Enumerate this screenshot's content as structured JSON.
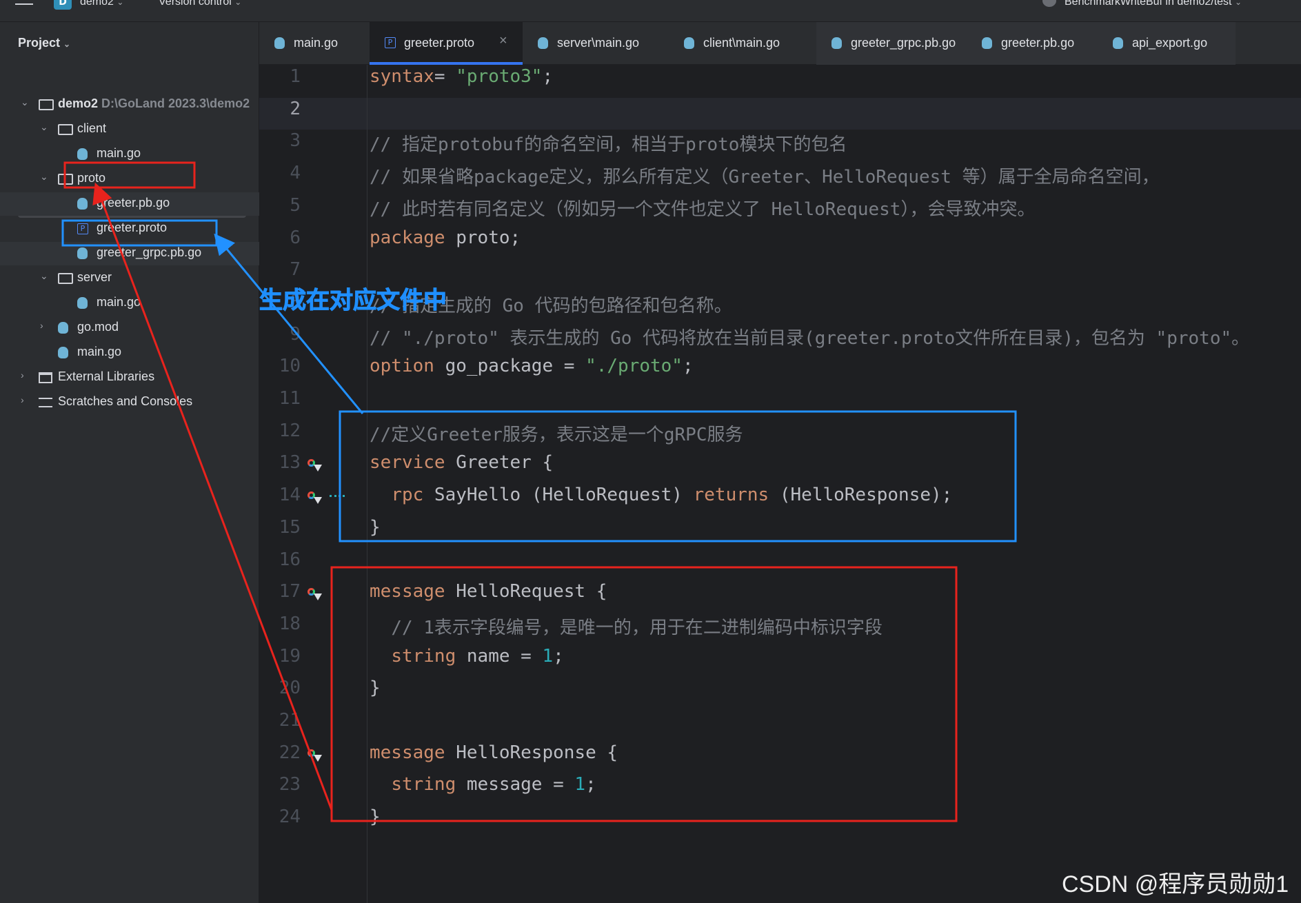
{
  "topbar": {
    "project_badge": "D",
    "project_name": "demo2",
    "vcs_label": "Version control",
    "run_config": "BenchmarkWriteBuf in demo2/test"
  },
  "sidebar": {
    "title": "Project",
    "tree": [
      {
        "label": "demo2",
        "path": "D:\\GoLand 2023.3\\demo2",
        "icon": "folder-icon"
      },
      {
        "label": "client",
        "icon": "folder-icon"
      },
      {
        "label": "main.go",
        "icon": "go-file-icon"
      },
      {
        "label": "proto",
        "icon": "folder-icon"
      },
      {
        "label": "greeter.pb.go",
        "icon": "go-file-icon"
      },
      {
        "label": "greeter.proto",
        "icon": "proto-file-icon"
      },
      {
        "label": "greeter_grpc.pb.go",
        "icon": "go-file-icon"
      },
      {
        "label": "server",
        "icon": "folder-icon"
      },
      {
        "label": "main.go",
        "icon": "go-file-icon"
      },
      {
        "label": "go.mod",
        "icon": "go-mod-icon"
      },
      {
        "label": "main.go",
        "icon": "go-file-icon"
      },
      {
        "label": "External Libraries",
        "icon": "library-icon"
      },
      {
        "label": "Scratches and Consoles",
        "icon": "scratches-icon"
      }
    ]
  },
  "tabs": [
    {
      "label": "main.go",
      "icon": "go-file-icon"
    },
    {
      "label": "greeter.proto",
      "icon": "proto-file-icon",
      "active": true,
      "close": "×"
    },
    {
      "label": "server\\main.go",
      "icon": "go-file-icon"
    },
    {
      "label": "client\\main.go",
      "icon": "go-file-icon"
    },
    {
      "label": "greeter_grpc.pb.go",
      "icon": "go-file-icon"
    },
    {
      "label": "greeter.pb.go",
      "icon": "go-file-icon"
    },
    {
      "label": "api_export.go",
      "icon": "go-file-icon"
    }
  ],
  "editor": {
    "current_line": 2,
    "line_numbers": [
      "1",
      "2",
      "3",
      "4",
      "5",
      "6",
      "7",
      "8",
      "9",
      "10",
      "11",
      "12",
      "13",
      "14",
      "15",
      "16",
      "17",
      "18",
      "19",
      "20",
      "21",
      "22",
      "23",
      "24"
    ],
    "lines": [
      {
        "t": [
          [
            "kw",
            "syntax"
          ],
          [
            "",
            "= "
          ],
          [
            "str",
            "\"proto3\""
          ],
          [
            "",
            ";"
          ]
        ]
      },
      {
        "t": []
      },
      {
        "t": [
          [
            "cmt",
            "// 指定protobuf的命名空间，相当于proto模块下的包名"
          ]
        ]
      },
      {
        "t": [
          [
            "cmt",
            "// 如果省略package定义，那么所有定义（Greeter、HelloRequest 等）属于全局命名空间，"
          ]
        ]
      },
      {
        "t": [
          [
            "cmt",
            "// 此时若有同名定义（例如另一个文件也定义了 HelloRequest），会导致冲突。"
          ]
        ]
      },
      {
        "t": [
          [
            "kw",
            "package"
          ],
          [
            "",
            " proto;"
          ]
        ]
      },
      {
        "t": []
      },
      {
        "t": [
          [
            "cmt",
            "// 指定生成的 Go 代码的包路径和包名称。"
          ]
        ]
      },
      {
        "t": [
          [
            "cmt",
            "// \"./proto\" 表示生成的 Go 代码将放在当前目录(greeter.proto文件所在目录)，包名为 \"proto\"。"
          ]
        ]
      },
      {
        "t": [
          [
            "kw",
            "option"
          ],
          [
            "",
            " go_package = "
          ],
          [
            "str",
            "\"./proto\""
          ],
          [
            "",
            ";"
          ]
        ]
      },
      {
        "t": []
      },
      {
        "t": [
          [
            "cmt",
            "//定义Greeter服务，表示这是一个gRPC服务"
          ]
        ]
      },
      {
        "t": [
          [
            "kw",
            "service"
          ],
          [
            "",
            " Greeter {"
          ]
        ]
      },
      {
        "t": [
          [
            "",
            "  "
          ],
          [
            "kw",
            "rpc"
          ],
          [
            "",
            " SayHello (HelloRequest) "
          ],
          [
            "kw",
            "returns"
          ],
          [
            "",
            " (HelloResponse);"
          ]
        ]
      },
      {
        "t": [
          [
            "",
            "}"
          ]
        ]
      },
      {
        "t": []
      },
      {
        "t": [
          [
            "kw",
            "message"
          ],
          [
            "",
            " HelloRequest {"
          ]
        ]
      },
      {
        "t": [
          [
            "",
            "  "
          ],
          [
            "cmt",
            "// 1表示字段编号，是唯一的，用于在二进制编码中标识字段"
          ]
        ]
      },
      {
        "t": [
          [
            "",
            "  "
          ],
          [
            "kw",
            "string"
          ],
          [
            "",
            " name = "
          ],
          [
            "num",
            "1"
          ],
          [
            "",
            ";"
          ]
        ]
      },
      {
        "t": [
          [
            "",
            "}"
          ]
        ]
      },
      {
        "t": []
      },
      {
        "t": [
          [
            "kw",
            "message"
          ],
          [
            "",
            " HelloResponse {"
          ]
        ]
      },
      {
        "t": [
          [
            "",
            "  "
          ],
          [
            "kw",
            "string"
          ],
          [
            "",
            " message = "
          ],
          [
            "num",
            "1"
          ],
          [
            "",
            ";"
          ]
        ]
      },
      {
        "t": [
          [
            "",
            "}"
          ]
        ]
      }
    ],
    "gutter_icons": [
      "13",
      "14",
      "17",
      "22"
    ]
  },
  "annotation": {
    "label": "生成在对应文件中",
    "red_color": "#e8231d",
    "blue_color": "#2291ff"
  },
  "watermark": "CSDN @程序员勋勋1"
}
